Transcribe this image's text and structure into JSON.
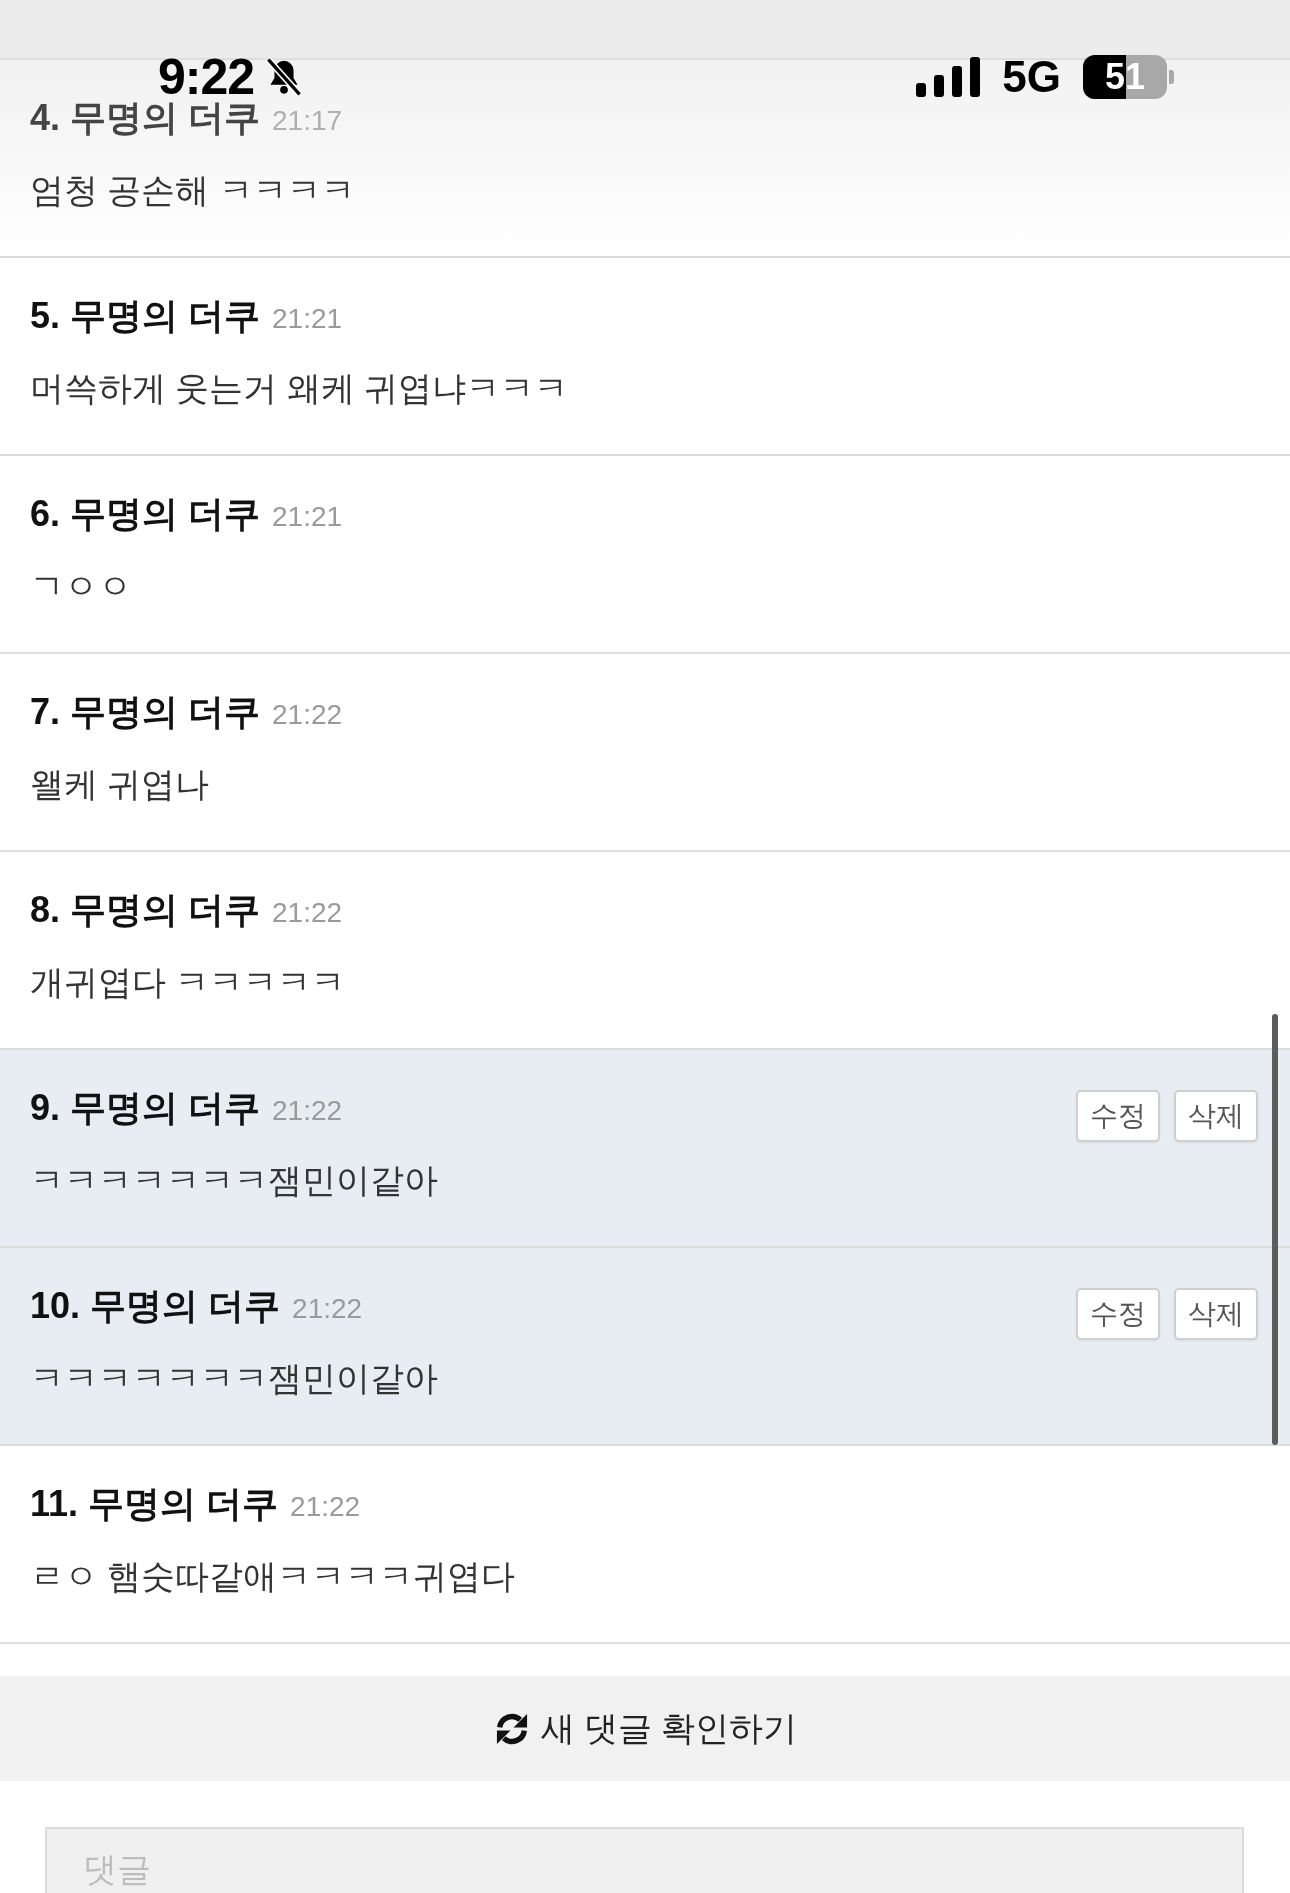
{
  "status_bar": {
    "time": "9:22",
    "silent": true,
    "network": "5G",
    "battery": {
      "percentage": "51",
      "level": 0.51
    }
  },
  "comments": [
    {
      "number": "4.",
      "author": "무명의 더쿠",
      "time": "21:17",
      "text": "엄청 공손해 ㅋㅋㅋㅋ",
      "own": false
    },
    {
      "number": "5.",
      "author": "무명의 더쿠",
      "time": "21:21",
      "text": "머쓱하게 웃는거 왜케 귀엽냐ㅋㅋㅋ",
      "own": false
    },
    {
      "number": "6.",
      "author": "무명의 더쿠",
      "time": "21:21",
      "text": "ㄱㅇㅇ",
      "own": false
    },
    {
      "number": "7.",
      "author": "무명의 더쿠",
      "time": "21:22",
      "text": "왤케 귀엽나",
      "own": false
    },
    {
      "number": "8.",
      "author": "무명의 더쿠",
      "time": "21:22",
      "text": "개귀엽다 ㅋㅋㅋㅋㅋ",
      "own": false
    },
    {
      "number": "9.",
      "author": "무명의 더쿠",
      "time": "21:22",
      "text": "ㅋㅋㅋㅋㅋㅋㅋ잼민이같아",
      "own": true,
      "actions": [
        "수정",
        "삭제"
      ]
    },
    {
      "number": "10.",
      "author": "무명의 더쿠",
      "time": "21:22",
      "text": "ㅋㅋㅋㅋㅋㅋㅋ잼민이같아",
      "own": true,
      "actions": [
        "수정",
        "삭제"
      ]
    },
    {
      "number": "11.",
      "author": "무명의 더쿠",
      "time": "21:22",
      "text": "ㄹㅇ 햄숫따같애ㅋㅋㅋㅋ귀엽다",
      "own": false
    }
  ],
  "refresh_button": {
    "label": "새 댓글 확인하기"
  },
  "comment_field": {
    "placeholder": "댓글"
  }
}
